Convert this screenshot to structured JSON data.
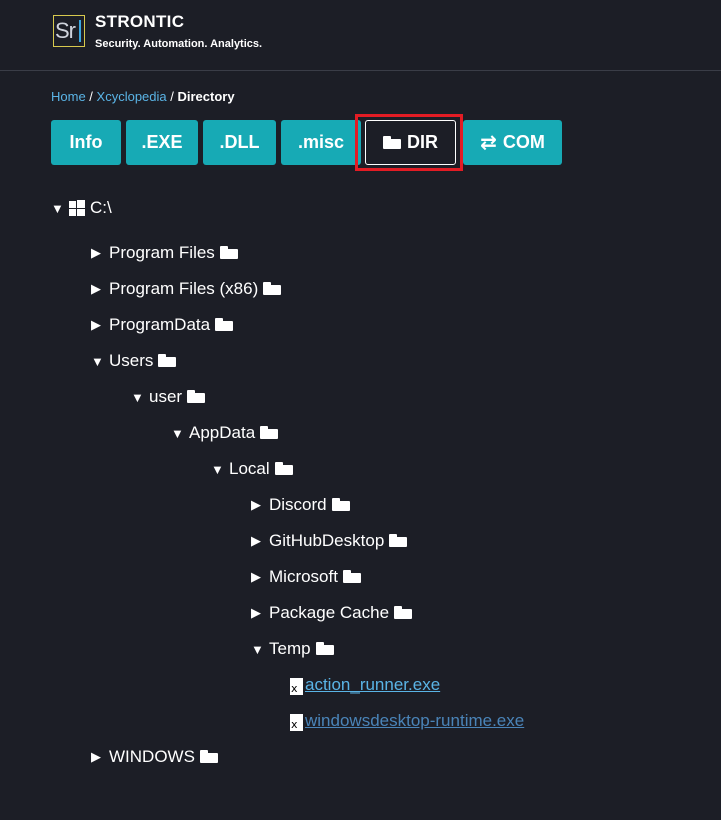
{
  "brand": {
    "logo_text": "Sr",
    "name": "STRONTIC",
    "tagline": "Security. Automation. Analytics."
  },
  "breadcrumb": {
    "home": "Home",
    "sep1": " / ",
    "xcyclopedia": "Xcyclopedia",
    "sep2": " / ",
    "current": "Directory"
  },
  "tabs": {
    "info": "Info",
    "exe": ".EXE",
    "dll": ".DLL",
    "misc": ".misc",
    "dir": "DIR",
    "com": "COM",
    "active": "DIR"
  },
  "tree": {
    "root": "C:\\",
    "program_files": "Program Files",
    "program_files_x86": "Program Files (x86)",
    "program_data": "ProgramData",
    "users": "Users",
    "user": "user",
    "appdata": "AppData",
    "local": "Local",
    "discord": "Discord",
    "github_desktop": "GitHubDesktop",
    "microsoft": "Microsoft",
    "package_cache": "Package Cache",
    "temp": "Temp",
    "file1": "action_runner.exe",
    "file2": "windowsdesktop-runtime.exe",
    "windows": "WINDOWS"
  },
  "icons": {
    "expanded": "▼",
    "collapsed": "▶",
    "folder": "folder-icon",
    "windows": "windows-logo-icon",
    "file": "file-icon",
    "swap": "⇄"
  },
  "colors": {
    "background": "#1c1e26",
    "tab": "#17aab5",
    "link": "#5ab4e6",
    "highlight": "#e31c24"
  }
}
